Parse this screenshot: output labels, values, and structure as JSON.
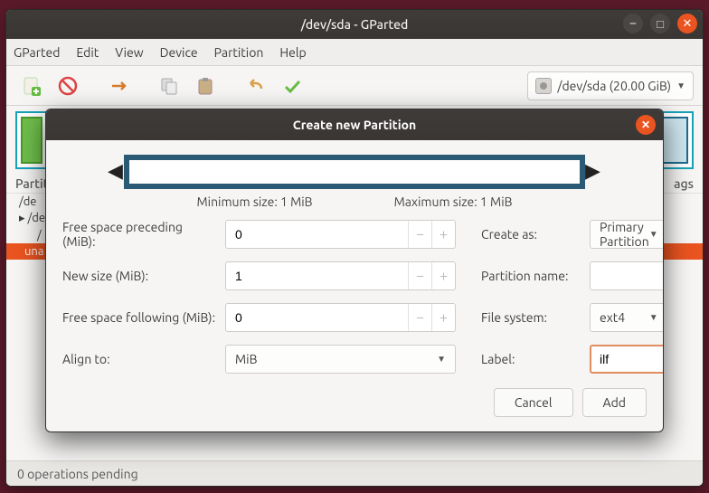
{
  "window": {
    "title": "/dev/sda - GParted"
  },
  "menu": {
    "gparted": "GParted",
    "edit": "Edit",
    "view": "View",
    "device": "Device",
    "partition": "Partition",
    "help": "Help"
  },
  "device_selector": "/dev/sda  (20.00 GiB)",
  "columns": {
    "left": "Partit",
    "right": "ags"
  },
  "rows": {
    "r1": "/de",
    "r2": "/de",
    "r3": "/",
    "una": "una"
  },
  "status": "0 operations pending",
  "dialog": {
    "title": "Create new Partition",
    "min_size": "Minimum size: 1 MiB",
    "max_size": "Maximum size: 1 MiB",
    "labels": {
      "free_before": "Free space preceding (MiB):",
      "new_size": "New size (MiB):",
      "free_after": "Free space following (MiB):",
      "align_to": "Align to:",
      "create_as": "Create as:",
      "partition_name": "Partition name:",
      "file_system": "File system:",
      "label": "Label:"
    },
    "values": {
      "free_before": "0",
      "new_size": "1",
      "free_after": "0",
      "align_to": "MiB",
      "create_as": "Primary Partition",
      "partition_name": "",
      "file_system": "ext4",
      "label": "ilf"
    },
    "buttons": {
      "cancel": "Cancel",
      "add": "Add"
    }
  }
}
